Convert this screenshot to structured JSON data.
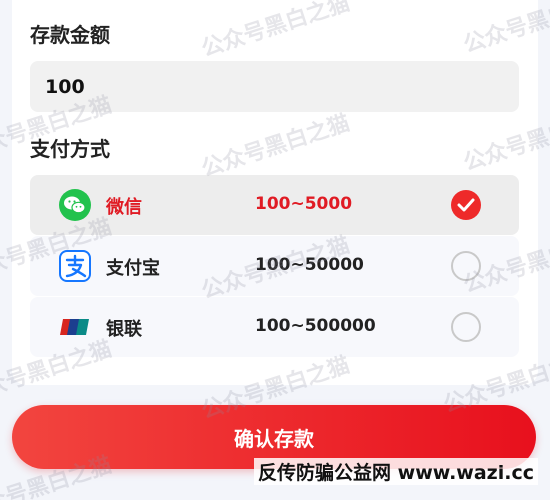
{
  "deposit": {
    "amount_label": "存款金额",
    "amount_value": "100",
    "payment_label": "支付方式"
  },
  "payment_methods": [
    {
      "name": "微信",
      "range": "100~5000",
      "icon": "wechat-icon",
      "selected": true
    },
    {
      "name": "支付宝",
      "range": "100~50000",
      "icon": "alipay-icon",
      "selected": false
    },
    {
      "name": "银联",
      "range": "100~500000",
      "icon": "unionpay-icon",
      "selected": false
    }
  ],
  "confirm_label": "确认存款",
  "watermark_text": "公众号黑白之猫",
  "footer_note": "反传防骗公益网 www.wazi.cc",
  "colors": {
    "accent": "#e01b24",
    "button_start": "#f2453f",
    "button_end": "#e8101d",
    "wechat": "#22c24d",
    "alipay": "#1677ff"
  }
}
